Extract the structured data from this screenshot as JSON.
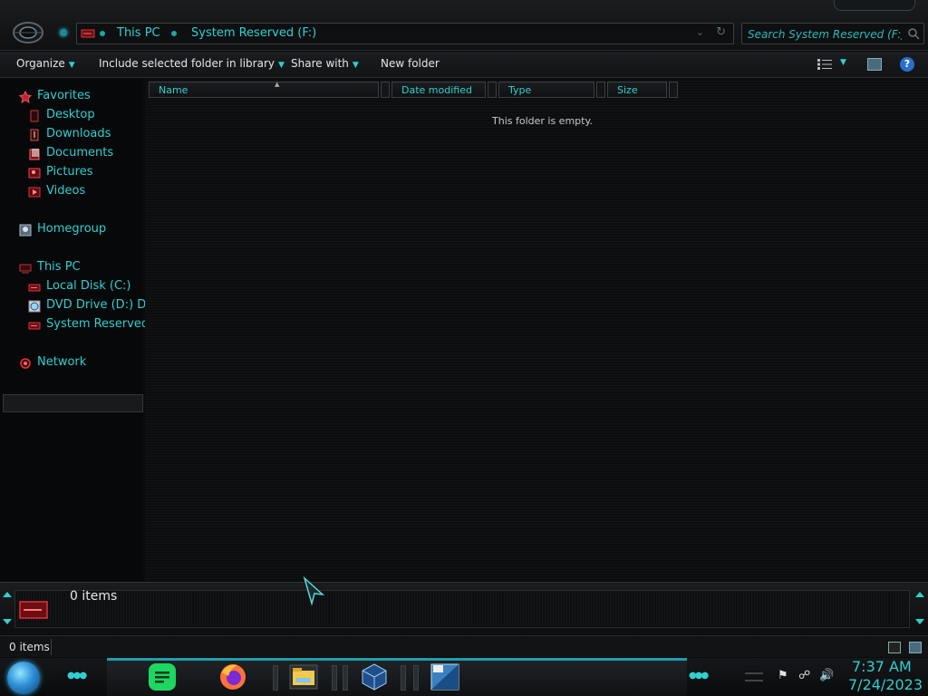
{
  "window": {
    "breadcrumbs": [
      "This PC",
      "System Reserved (F:)"
    ],
    "search": {
      "placeholder": "Search System Reserved (F:)"
    }
  },
  "toolbar": {
    "organize": "Organize",
    "include_in_library": "Include selected folder in library",
    "share_with": "Share with",
    "new_folder": "New folder",
    "help_glyph": "?"
  },
  "nav": {
    "favorites": "Favorites",
    "favorites_items": [
      "Desktop",
      "Downloads",
      "Documents",
      "Pictures",
      "Videos"
    ],
    "homegroup": "Homegroup",
    "this_pc": "This PC",
    "drives": [
      "Local Disk (C:)",
      "DVD Drive (D:) DV",
      "System Reserved"
    ],
    "network": "Network"
  },
  "content": {
    "columns": [
      "Name",
      "Date modified",
      "Type",
      "Size"
    ],
    "empty_message": "This folder is empty."
  },
  "details": {
    "item_count": "0 items"
  },
  "status": {
    "item_count": "0 items"
  },
  "taskbar": {
    "clock_time": "7:37 AM",
    "clock_date": "7/24/2023",
    "apps": [
      "spotify-icon",
      "firefox-icon",
      "file-explorer-icon",
      "virtualbox-icon",
      "windows7-64-icon"
    ]
  },
  "colors": {
    "accent": "#2fd0d0",
    "background": "#0a0b0c"
  }
}
